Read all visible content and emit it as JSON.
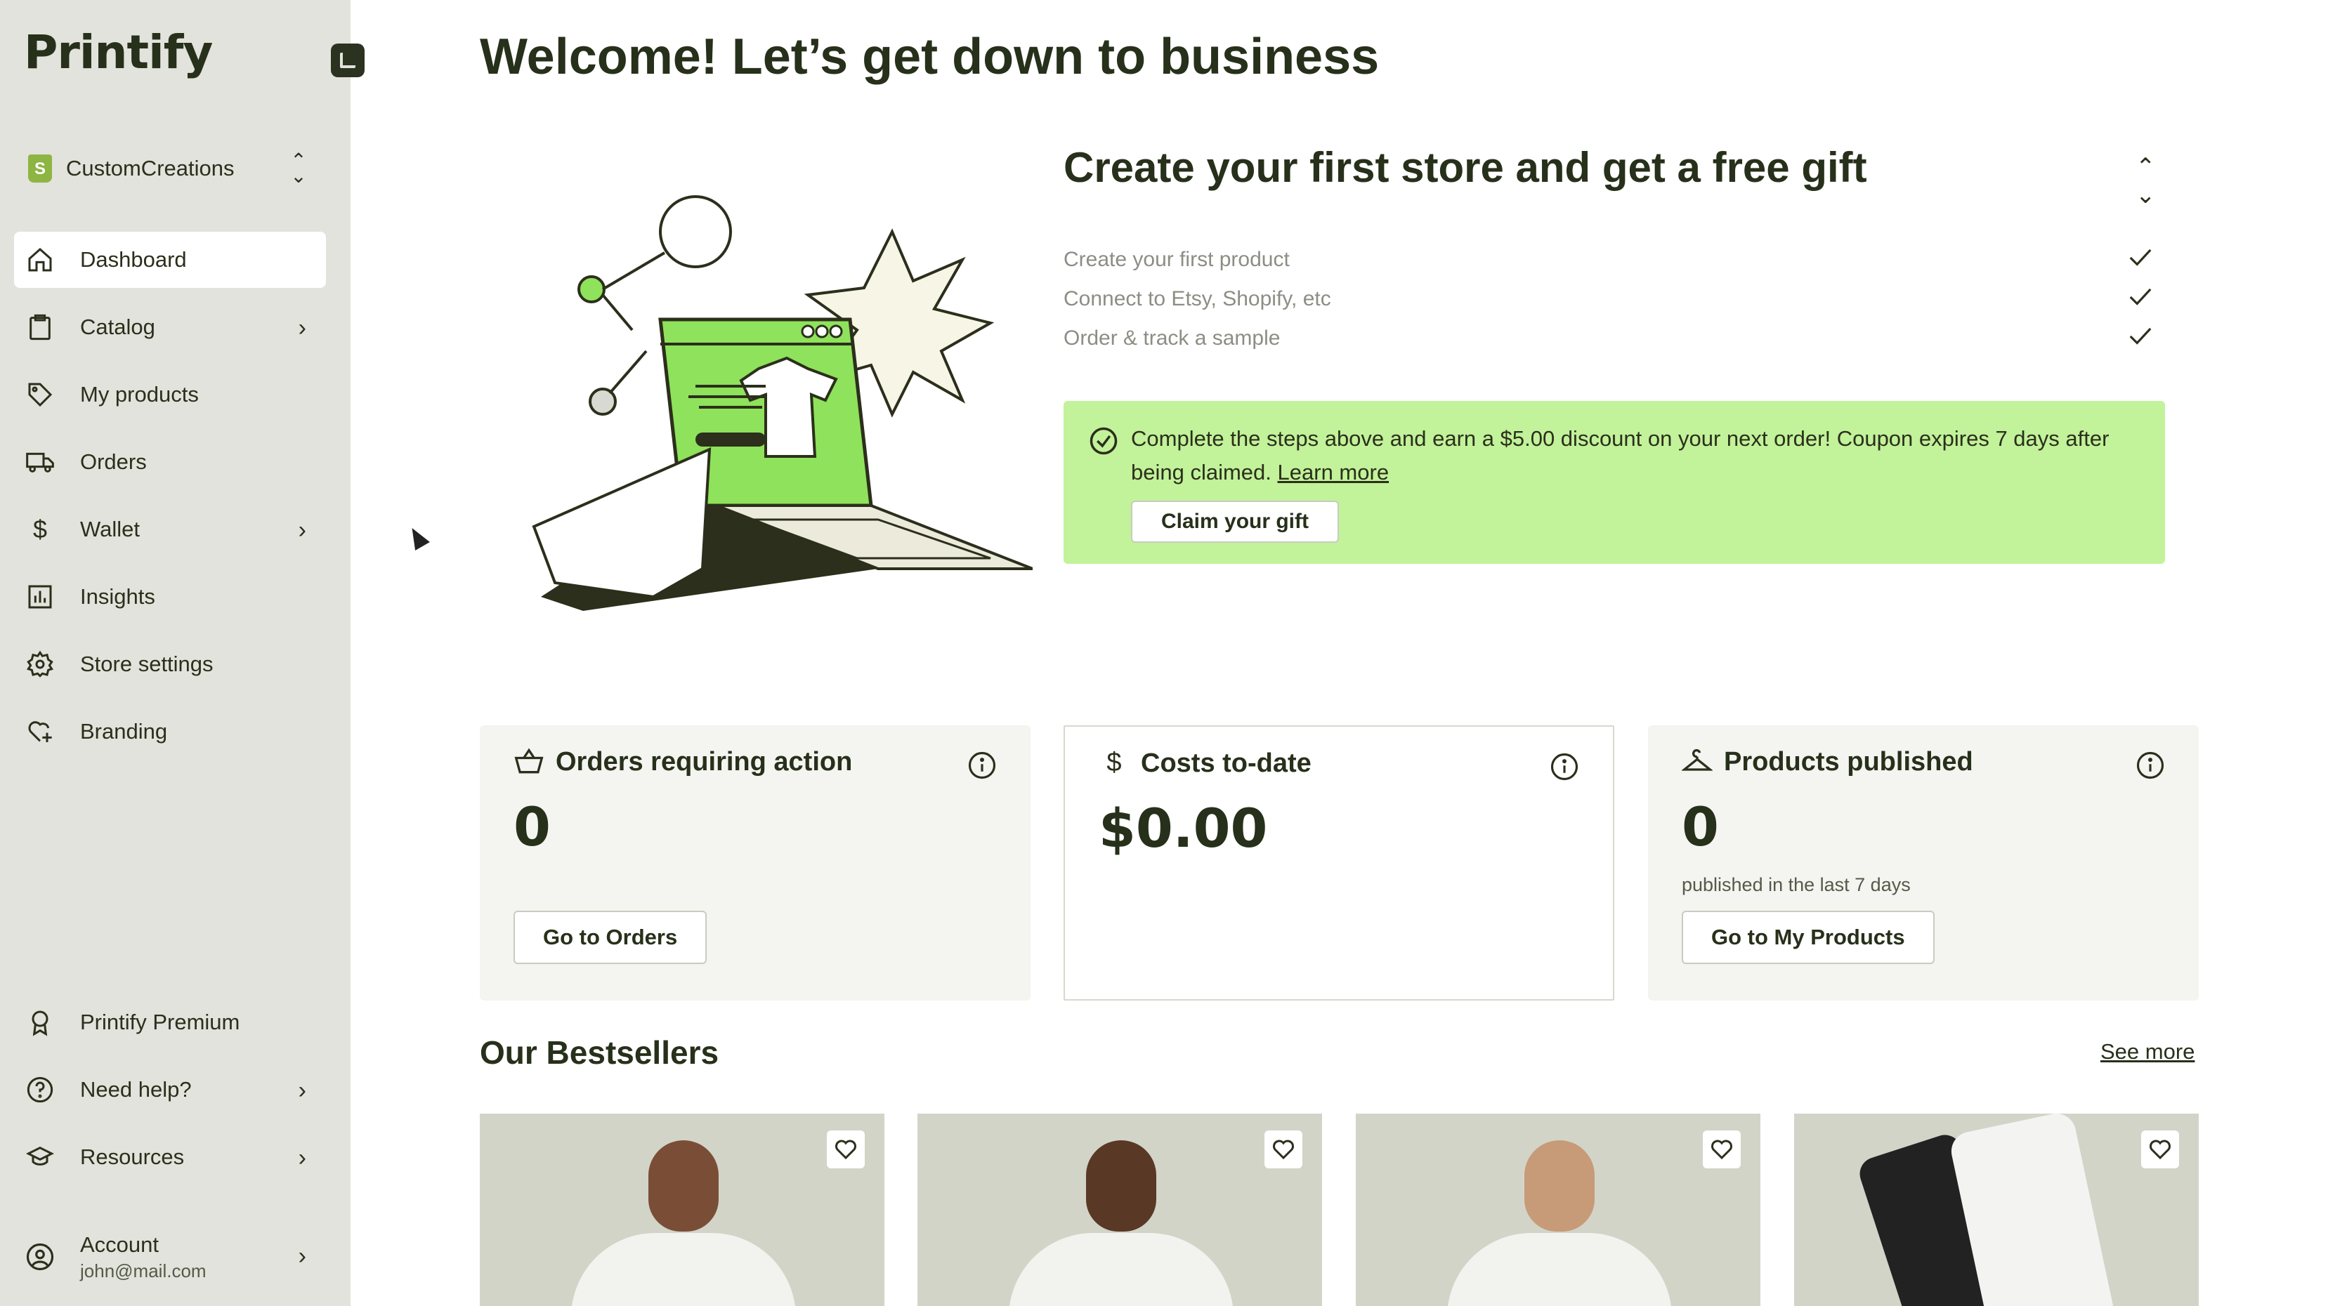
{
  "app": {
    "logo": "Printify"
  },
  "store": {
    "name": "CustomCreations"
  },
  "sidebar": {
    "items": [
      {
        "label": "Dashboard",
        "icon": "home-icon",
        "active": true,
        "has_chevron": false
      },
      {
        "label": "Catalog",
        "icon": "clipboard-icon",
        "has_chevron": true
      },
      {
        "label": "My products",
        "icon": "tag-icon",
        "has_chevron": false
      },
      {
        "label": "Orders",
        "icon": "truck-icon",
        "has_chevron": false
      },
      {
        "label": "Wallet",
        "icon": "dollar-icon",
        "has_chevron": true
      },
      {
        "label": "Insights",
        "icon": "bar-chart-icon",
        "has_chevron": false
      },
      {
        "label": "Store settings",
        "icon": "gear-icon",
        "has_chevron": false
      },
      {
        "label": "Branding",
        "icon": "heart-plus-icon",
        "has_chevron": false
      }
    ],
    "bottom_items": [
      {
        "label": "Printify Premium",
        "icon": "badge-icon",
        "has_chevron": false
      },
      {
        "label": "Need help?",
        "icon": "help-icon",
        "has_chevron": true
      },
      {
        "label": "Resources",
        "icon": "graduation-cap-icon",
        "has_chevron": true
      }
    ],
    "account": {
      "label": "Account",
      "email": "john@mail.com"
    }
  },
  "main": {
    "title": "Welcome! Let’s get down to business",
    "gift": {
      "title": "Create your first store and get a free gift",
      "steps": [
        "Create your first product",
        "Connect to Etsy, Shopify, etc",
        "Order & track a sample"
      ],
      "promo_text": "Complete the steps above and earn a $5.00 discount on your next order! Coupon expires 7 days after being claimed.",
      "learn_more": "Learn more",
      "claim_button": "Claim your gift"
    },
    "cards": [
      {
        "title": "Orders requiring action",
        "value": "0",
        "subtitle": "",
        "button": "Go to Orders",
        "icon": "basket-icon"
      },
      {
        "title": "Costs to-date",
        "value": "$0.00",
        "subtitle": "",
        "button": "",
        "icon": "dollar-icon"
      },
      {
        "title": "Products published",
        "value": "0",
        "subtitle": "published in the last 7 days",
        "button": "Go to My Products",
        "icon": "hanger-icon"
      }
    ],
    "bestsellers": {
      "title": "Our Bestsellers",
      "see_more": "See more"
    }
  },
  "colors": {
    "sidebar_bg": "#e2e3dc",
    "accent_green": "#c2f29a",
    "text_dark": "#27301a"
  }
}
